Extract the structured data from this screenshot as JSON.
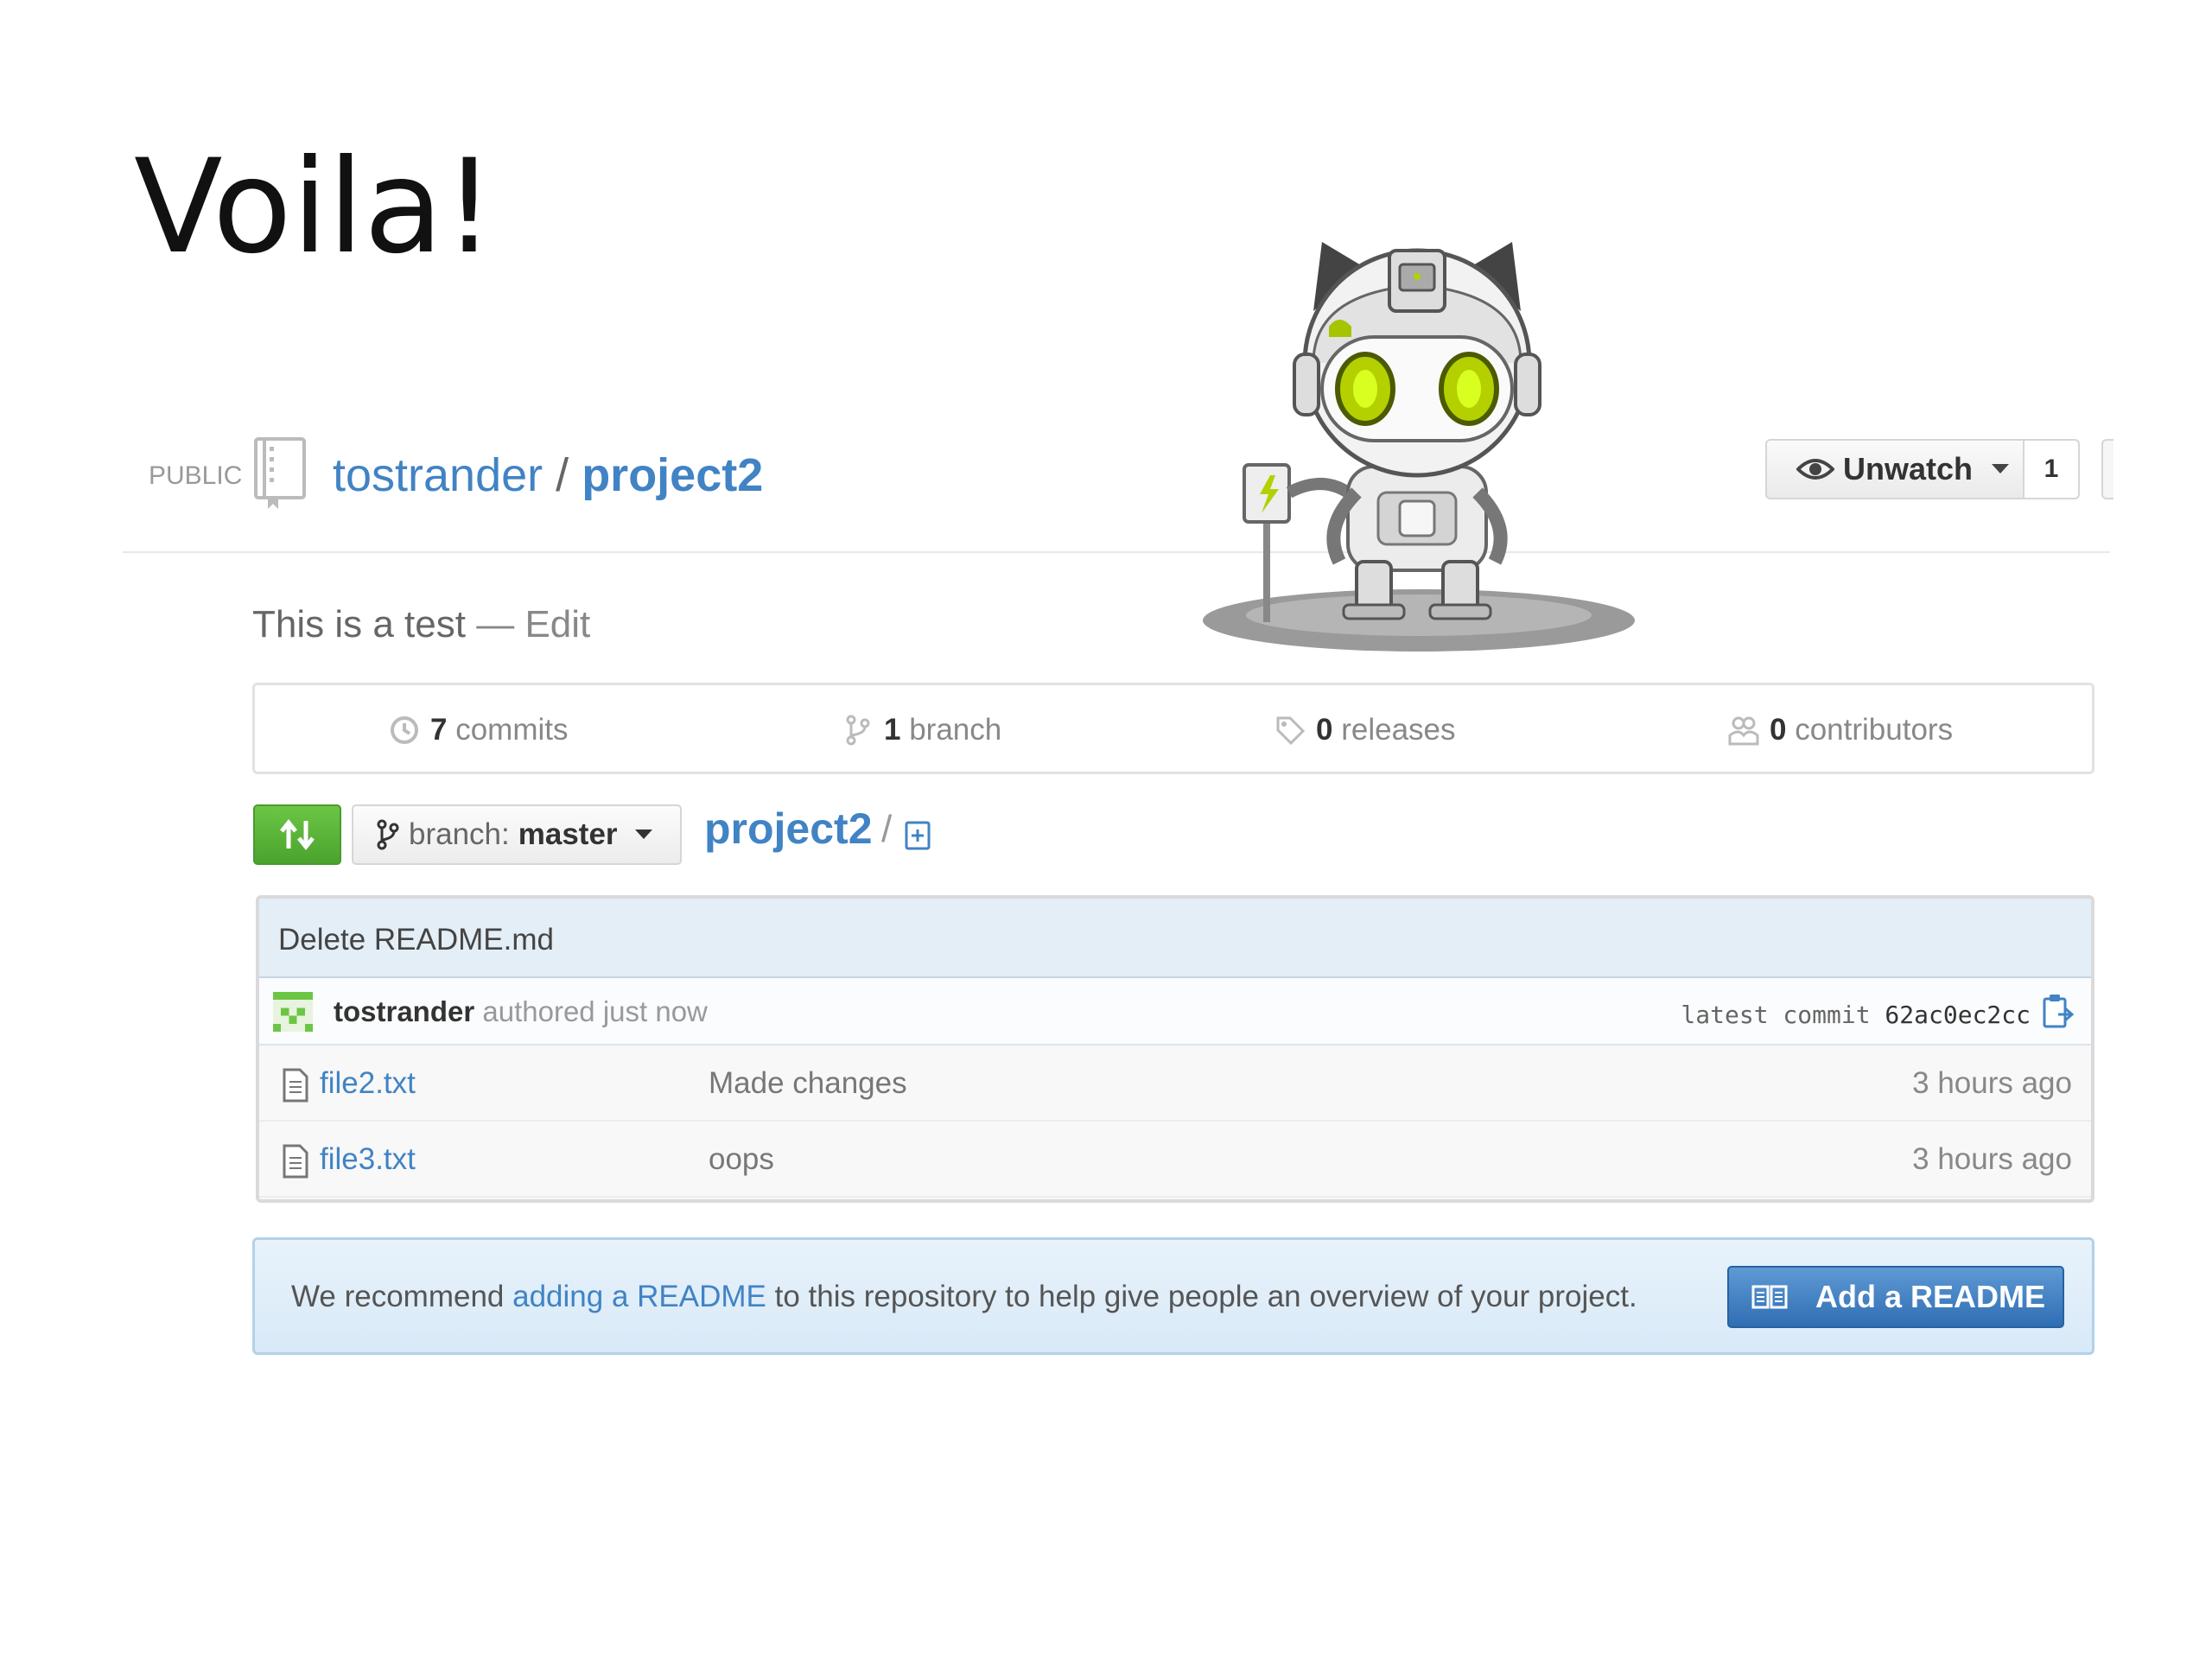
{
  "slide": {
    "title": "Voila!"
  },
  "repo": {
    "visibility": "PUBLIC",
    "owner": "tostrander",
    "separator": "/",
    "name": "project2",
    "description": "This is a test",
    "description_dash": "—",
    "edit_label": "Edit"
  },
  "watch": {
    "label": "Unwatch",
    "count": "1"
  },
  "stats": {
    "commits": {
      "count": "7",
      "label": "commits"
    },
    "branches": {
      "count": "1",
      "label": "branch"
    },
    "releases": {
      "count": "0",
      "label": "releases"
    },
    "contributors": {
      "count": "0",
      "label": "contributors"
    }
  },
  "toolbar": {
    "branch_prefix": "branch:",
    "branch_name": "master",
    "path_root": "project2",
    "path_sep": "/"
  },
  "commit": {
    "message": "Delete README.md",
    "author": "tostrander",
    "authored_text": "authored just now",
    "latest_label": "latest commit",
    "sha": "62ac0ec2cc"
  },
  "files": [
    {
      "name": "file2.txt",
      "message": "Made changes",
      "age": "3 hours ago"
    },
    {
      "name": "file3.txt",
      "message": "oops",
      "age": "3 hours ago"
    }
  ],
  "readme_banner": {
    "prefix": "We recommend",
    "link": "adding a README",
    "suffix": "to this repository to help give people an overview of your project.",
    "button": "Add a README"
  },
  "colors": {
    "link": "#4183c4",
    "green_button": "#6cc644",
    "blue_button": "#2f6eb3",
    "banner": "#e8f3fb"
  },
  "icons": [
    "repo-icon",
    "eye-icon",
    "history-icon",
    "branch-icon",
    "tag-icon",
    "people-icon",
    "compare-icon",
    "plus-file-icon",
    "file-icon",
    "clipboard-icon",
    "book-icon",
    "octocat-robot"
  ]
}
